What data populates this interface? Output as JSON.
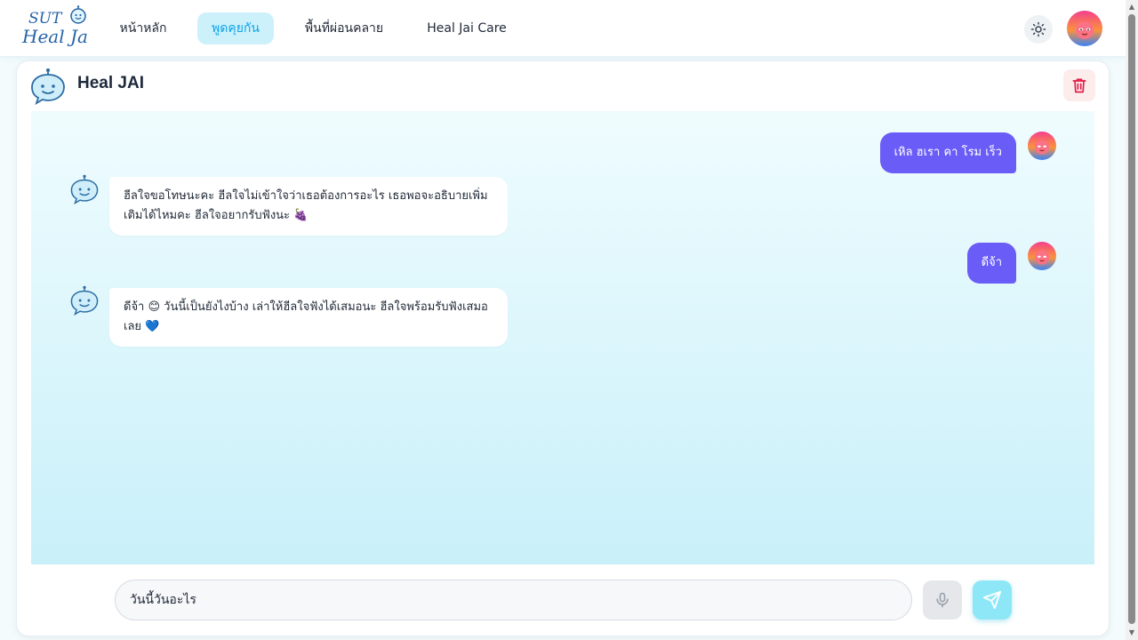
{
  "nav": {
    "logo_top": "SUT",
    "logo_bottom": "Heal Jai",
    "items": [
      {
        "label": "หน้าหลัก",
        "active": false
      },
      {
        "label": "พูดคุยกัน",
        "active": true
      },
      {
        "label": "พื้นที่ผ่อนคลาย",
        "active": false
      },
      {
        "label": "Heal Jai Care",
        "active": false
      }
    ],
    "theme_icon": "sun-icon",
    "user_avatar": "user-avatar"
  },
  "chat": {
    "title": "Heal JAI",
    "delete_icon": "trash-icon",
    "messages": [
      {
        "role": "user",
        "text": "เหิล ฮเรา คา โรม เร็ว"
      },
      {
        "role": "bot",
        "text": "ฮีลใจขอโทษนะคะ ฮีลใจไม่เข้าใจว่าเธอต้องการอะไร เธอพอจะอธิบายเพิ่มเติมได้ไหมคะ ฮีลใจอยากรับฟังนะ 🍇"
      },
      {
        "role": "user",
        "text": "ดีจ้า"
      },
      {
        "role": "bot",
        "text": "ดีจ้า 😊 วันนี้เป็นยังไงบ้าง เล่าให้ฮีลใจฟังได้เสมอนะ ฮีลใจพร้อมรับฟังเสมอเลย 💙"
      }
    ]
  },
  "input": {
    "value": "วันนี้วันอะไร",
    "mic_icon": "microphone-icon",
    "send_icon": "send-icon"
  },
  "colors": {
    "user_bubble": "#6a5cf7",
    "active_nav_bg": "#cdf1fb",
    "active_nav_text": "#0ea5e9",
    "send_button": "#8ee7f7",
    "delete_icon": "#e11d48"
  }
}
